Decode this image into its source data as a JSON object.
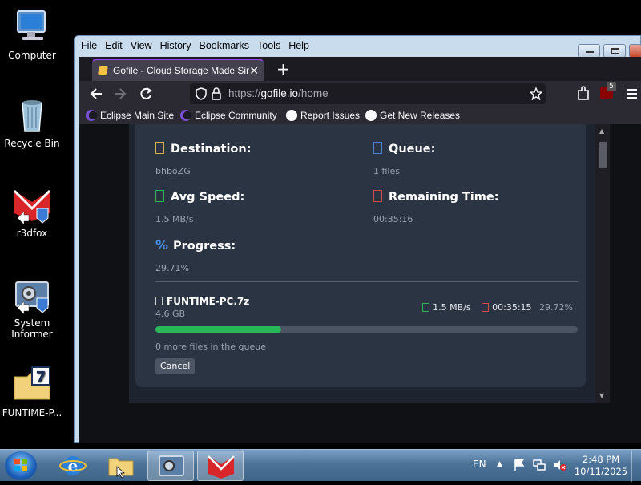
{
  "desktop": {
    "icons": [
      {
        "label": "Computer"
      },
      {
        "label": "Recycle Bin"
      },
      {
        "label": "r3dfox"
      },
      {
        "label": "System Informer"
      },
      {
        "label": "FUNTIME-P..."
      }
    ]
  },
  "browser": {
    "menu": [
      "File",
      "Edit",
      "View",
      "History",
      "Bookmarks",
      "Tools",
      "Help"
    ],
    "tab_title": "Gofile - Cloud Storage Made Sir",
    "url_prefix": "https://",
    "url_host": "gofile.io",
    "url_path": "/home",
    "extension_badge": "5",
    "bookmarks": [
      {
        "label": "Eclipse Main Site"
      },
      {
        "label": "Eclipse Community"
      },
      {
        "label": "Report Issues"
      },
      {
        "label": "Get New Releases"
      }
    ]
  },
  "transfer": {
    "destination_label": "Destination:",
    "destination_value": "bhboZG",
    "queue_label": "Queue:",
    "queue_value": "1 files",
    "speed_label": "Avg Speed:",
    "speed_value": "1.5 MB/s",
    "remaining_label": "Remaining Time:",
    "remaining_value": "00:35:16",
    "progress_label": "Progress:",
    "progress_value": "29.71%",
    "file_name": "FUNTIME-PC.7z",
    "file_size": "4.6 GB",
    "file_speed": "1.5 MB/s",
    "file_remaining": "00:35:15",
    "file_percent": "29.72%",
    "file_progress_fraction": 0.2972,
    "queue_note": "0 more files in the queue",
    "cancel_label": "Cancel"
  },
  "taskbar": {
    "language": "EN",
    "time": "2:48 PM",
    "date": "10/11/2025"
  },
  "colors": {
    "progress_fill": "#2ab75a",
    "tab_accent": "#a347ff"
  }
}
